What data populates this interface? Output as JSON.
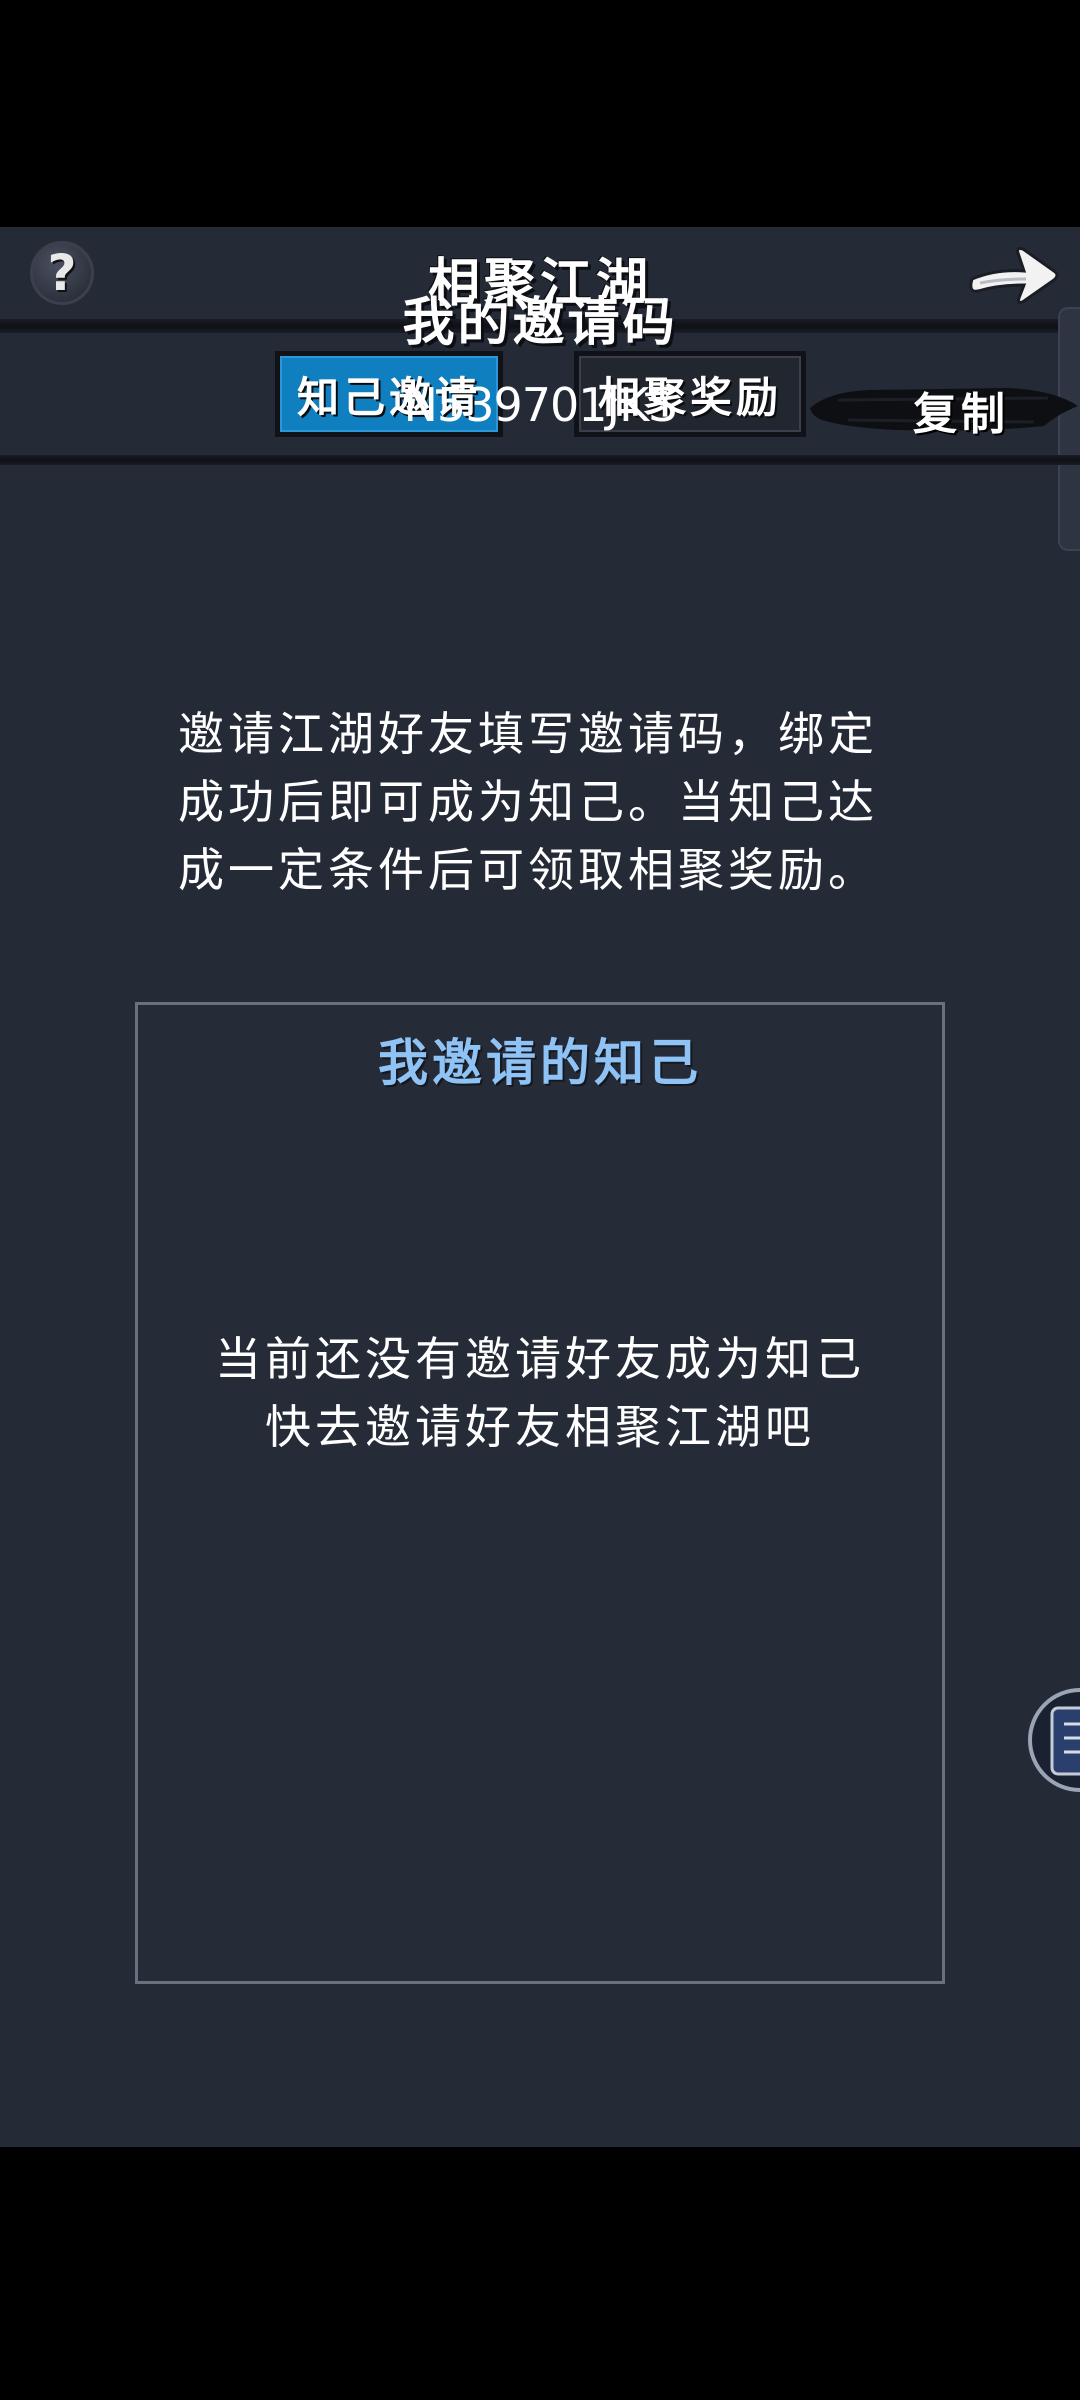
{
  "header": {
    "title": "相聚江湖",
    "help_icon": "question-mark-icon",
    "back_icon": "arrow-right-icon"
  },
  "tabs": [
    {
      "label": "知己邀请",
      "active": true
    },
    {
      "label": "相聚奖励",
      "active": false
    }
  ],
  "invite": {
    "heading": "我的邀请码",
    "code": "N539701JKS",
    "copy_label": "复制"
  },
  "description": {
    "lines": [
      "邀请江湖好友填写邀请码，绑定",
      "成功后即可成为知己。当知己达",
      "成一定条件后可领取相聚奖励。"
    ]
  },
  "friends": {
    "title": "我邀请的知己",
    "empty_lines": [
      "当前还没有邀请好友成为知己",
      "快去邀请好友相聚江湖吧"
    ]
  },
  "colors": {
    "panel_bg": "#252a37",
    "active_tab": "#0f7fc0",
    "friends_title": "#8fc3f5",
    "box_border": "#6a707d"
  }
}
